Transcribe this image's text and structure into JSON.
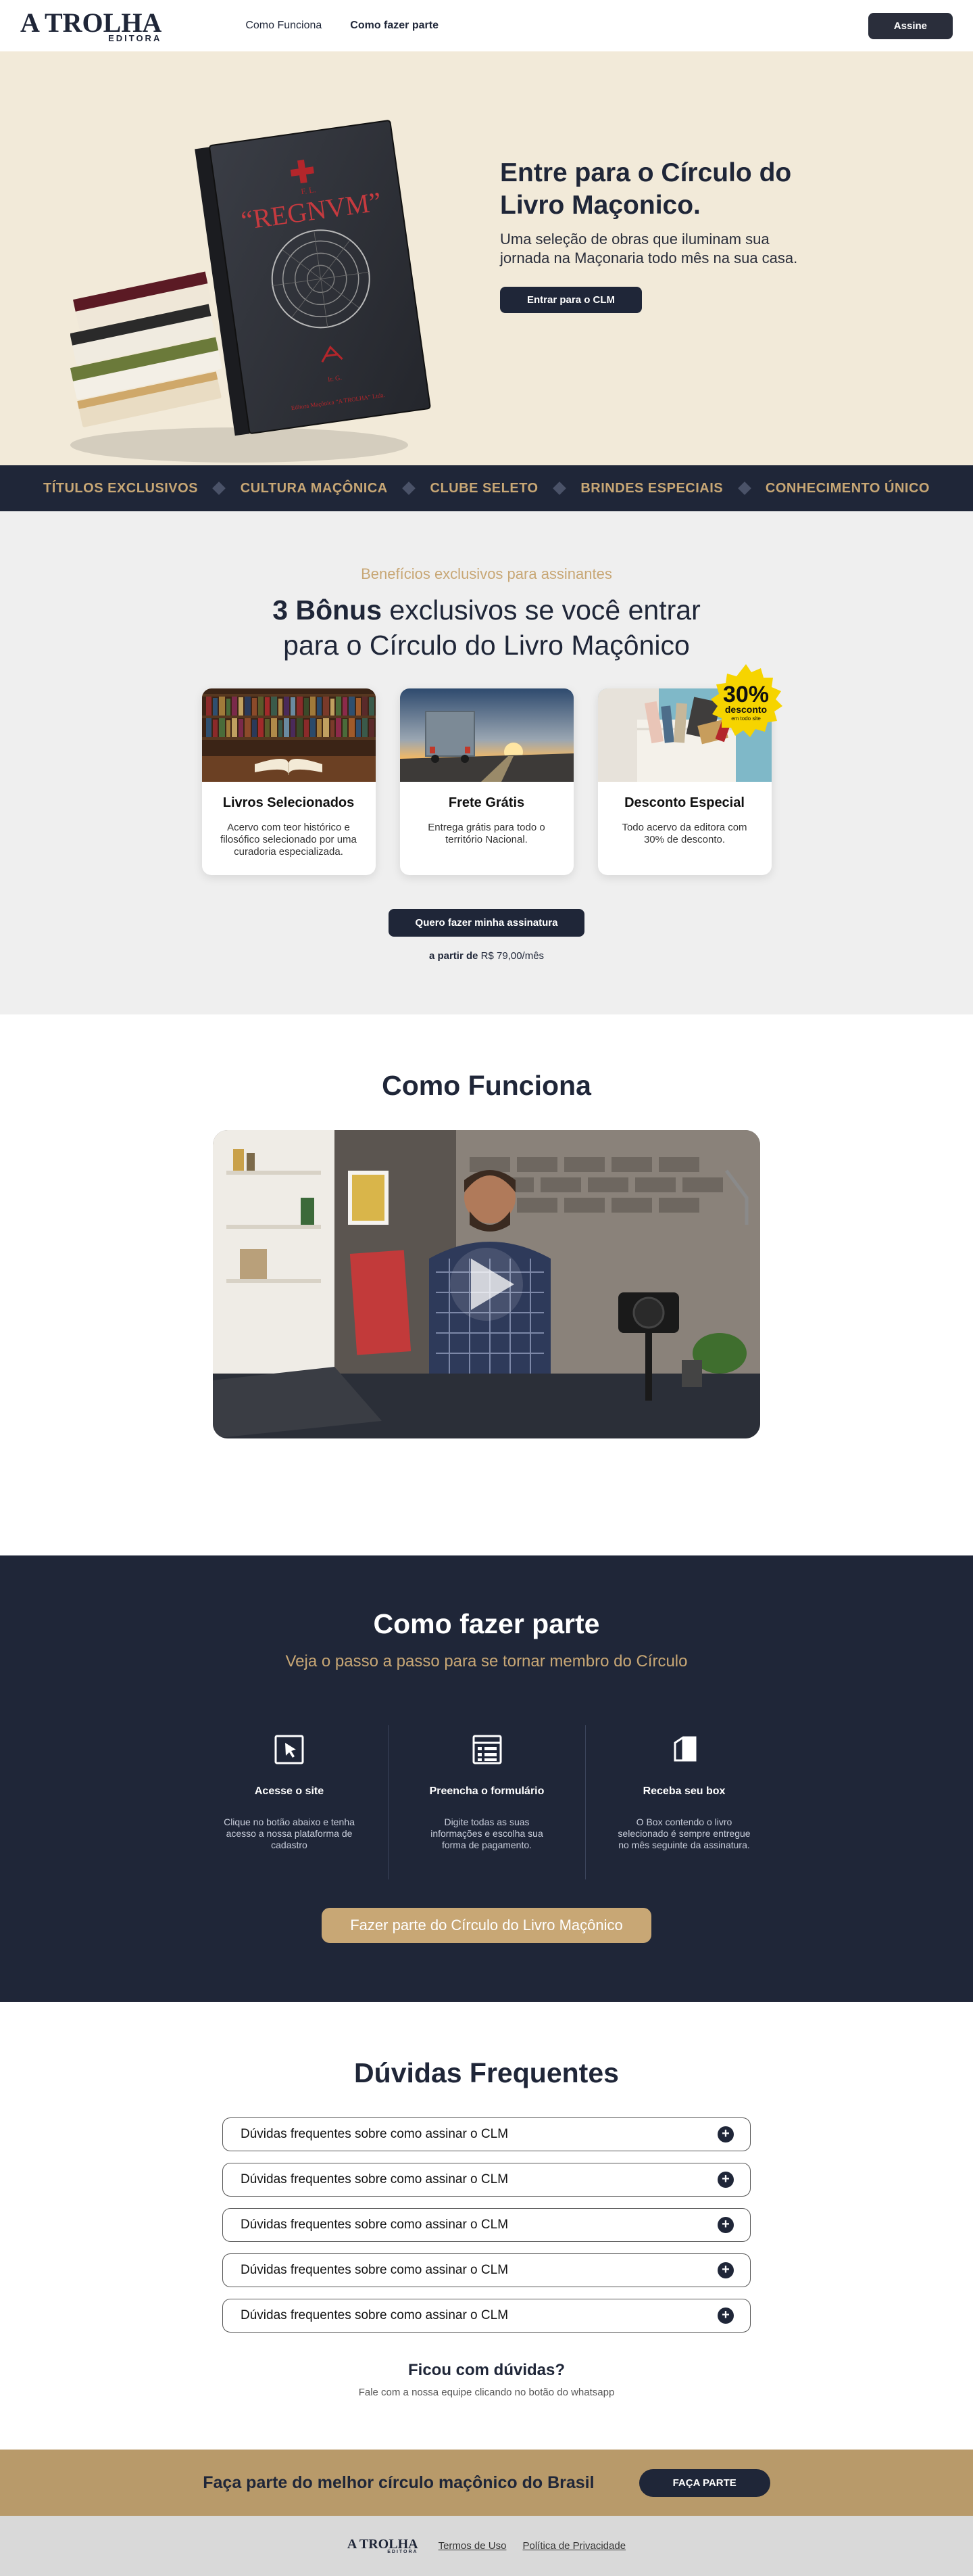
{
  "header": {
    "logo_main": "A TROLHA",
    "logo_sub": "EDITORA",
    "nav": [
      "Como Funciona",
      "Como fazer parte"
    ],
    "cta": "Assine"
  },
  "hero": {
    "book_title": "“REGNVM”",
    "book_publisher": "Editora Maçônica “A TROLHA” Ltda.",
    "title": "Entre para o Círculo do Livro Maçonico.",
    "text": "Uma seleção de obras que iluminam sua jornada na Maçonaria todo mês na sua casa.",
    "button": "Entrar para o CLM"
  },
  "marquee": [
    "TÍTULOS EXCLUSIVOS",
    "CULTURA MAÇÔNICA",
    "CLUBE SELETO",
    "BRINDES ESPECIAIS",
    "CONHECIMENTO ÚNICO"
  ],
  "benefits": {
    "eyebrow": "Benefícios exclusivos para assinantes",
    "title_bold": "3 Bônus",
    "title_rest": " exclusivos se você entrar",
    "title_line2": "para o Círculo do Livro Maçônico",
    "cards": [
      {
        "title": "Livros Selecionados",
        "text": "Acervo com teor histórico e filosófico selecionado por uma curadoria especializada."
      },
      {
        "title": "Frete Grátis",
        "text": "Entrega grátis para todo o território Nacional."
      },
      {
        "title": "Desconto Especial",
        "text": "Todo acervo da editora com 30% de desconto."
      }
    ],
    "badge_big": "30%",
    "badge_mid": "desconto",
    "badge_small": "em todo site",
    "button": "Quero fazer minha assinatura",
    "price_prefix": "a partir de",
    "price_value": " R$ 79,00/mês"
  },
  "video": {
    "title": "Como Funciona"
  },
  "join": {
    "title": "Como fazer parte",
    "subtitle": "Veja o passo a passo para se tornar membro do Círculo",
    "steps": [
      {
        "title": "Acesse o site",
        "text": "Clique no botão abaixo e tenha acesso a nossa plataforma de cadastro"
      },
      {
        "title": "Preencha o formulário",
        "text": "Digite todas as suas informações e escolha sua forma de pagamento."
      },
      {
        "title": "Receba seu box",
        "text": "O Box contendo o livro selecionado é sempre entregue no mês seguinte da assinatura."
      }
    ],
    "button": "Fazer parte do Círculo do Livro Maçônico"
  },
  "faq": {
    "title": "Dúvidas Frequentes",
    "items": [
      "Dúvidas frequentes sobre como assinar o CLM",
      "Dúvidas frequentes sobre como assinar o CLM",
      "Dúvidas frequentes sobre como assinar o CLM",
      "Dúvidas frequentes sobre como assinar o CLM",
      "Dúvidas frequentes sobre como assinar o CLM"
    ],
    "question": "Ficou com dúvidas?",
    "question_sub": "Fale com a nossa equipe clicando no botão do whatsapp"
  },
  "cta_band": {
    "text": "Faça parte do melhor círculo maçônico do Brasil",
    "button": "FAÇA PARTE"
  },
  "footer": {
    "logo_main": "A TROLHA",
    "logo_sub": "EDITORA",
    "links": [
      "Termos de Uso",
      "Política de Privacidade"
    ]
  },
  "colors": {
    "navy": "#1f2638",
    "gold": "#c8a775",
    "cream": "#f2ead9",
    "band": "#b89a6a"
  }
}
